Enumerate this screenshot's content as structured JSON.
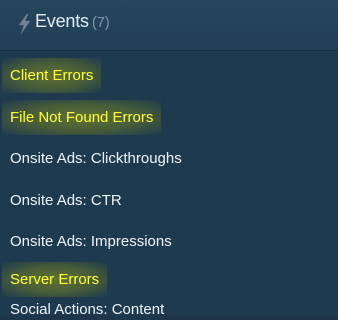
{
  "header": {
    "title": "Events",
    "count": "(7)",
    "icon": "lightning-bolt-icon"
  },
  "events": [
    {
      "label": "Client Errors",
      "highlighted": true
    },
    {
      "label": "File Not Found Errors",
      "highlighted": true
    },
    {
      "label": "Onsite Ads: Clickthroughs",
      "highlighted": false
    },
    {
      "label": "Onsite Ads: CTR",
      "highlighted": false
    },
    {
      "label": "Onsite Ads: Impressions",
      "highlighted": false
    },
    {
      "label": "Server Errors",
      "highlighted": true
    },
    {
      "label": "Social Actions: Content",
      "highlighted": false
    }
  ],
  "colors": {
    "background": "#1e3a4f",
    "highlight_text": "#ffff3a",
    "highlight_glow": "#96a014"
  }
}
